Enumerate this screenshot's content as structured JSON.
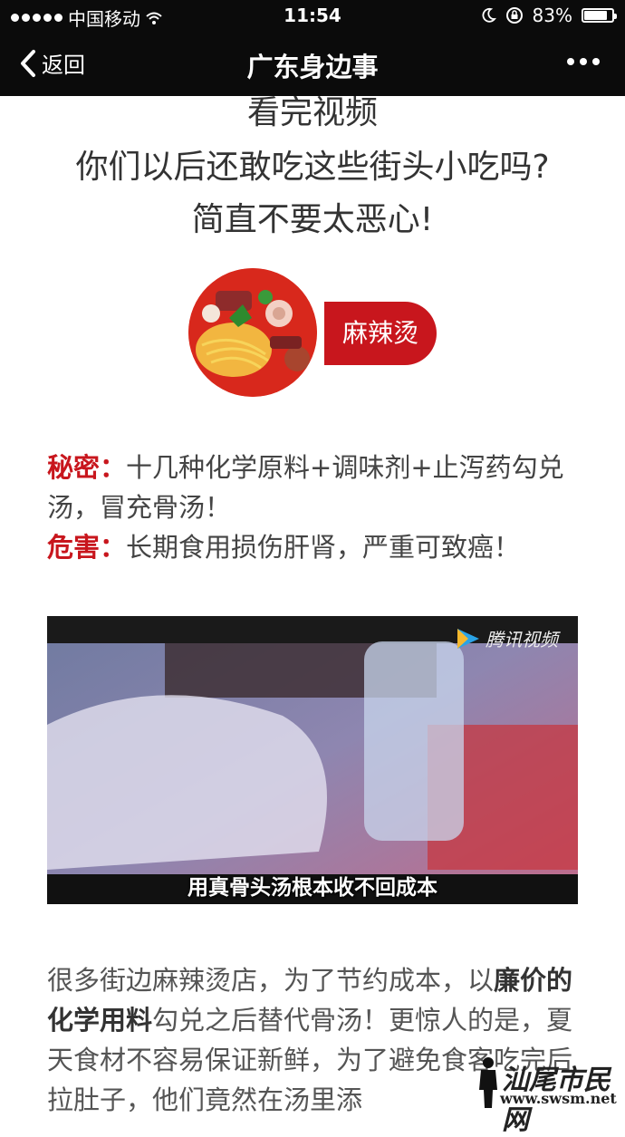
{
  "status_bar": {
    "carrier": "中国移动",
    "time": "11:54",
    "battery_percent": "83%",
    "battery_level": 0.83
  },
  "nav": {
    "back_label": "返回",
    "title": "广东身边事"
  },
  "article": {
    "headline_1": "看完视频",
    "headline_2": "你们以后还敢吃这些街头小吃吗?",
    "headline_3": "简直不要太恶心!",
    "tag_label": "麻辣烫",
    "secret_label": "秘密：",
    "secret_text": "十几种化学原料+调味剂+止泻药勾兑汤，冒充骨汤！",
    "harm_label": "危害：",
    "harm_text": "长期食用损伤肝肾，严重可致癌！",
    "video": {
      "logo_text": "腾讯视频",
      "subtitle": "用真骨头汤根本收不回成本"
    },
    "body_part1": "很多街边麻辣烫店，为了节约成本，以",
    "body_bold": "廉价的化学用料",
    "body_part2": "勾兑之后替代骨汤！更惊人的是，夏天食材不容易保证新鲜，为了避免食客吃完后拉肚子，他们竟然在汤里添"
  },
  "watermark": {
    "text": "汕尾市民网",
    "url": "www.swsm.net"
  },
  "colors": {
    "accent_red": "#c8161d",
    "bar_black": "#0b0b0b"
  }
}
